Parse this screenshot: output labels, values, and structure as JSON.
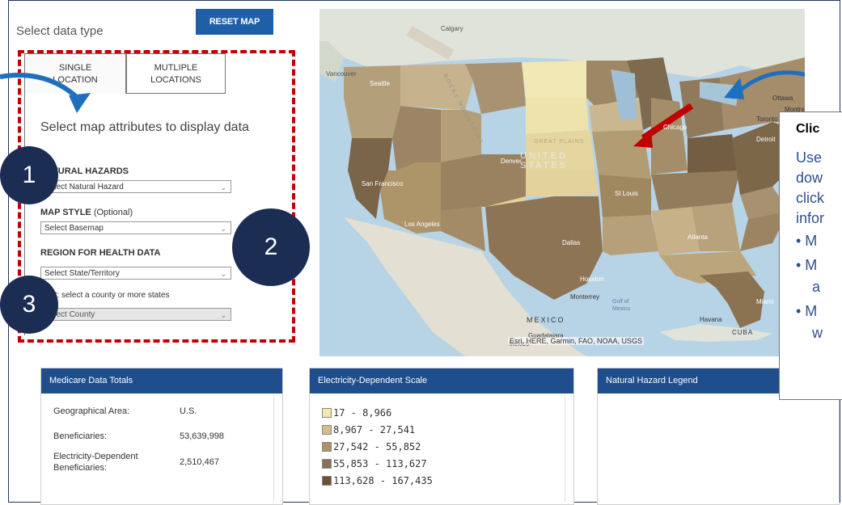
{
  "panel": {
    "select_label": "Select data type",
    "reset_label": "RESET MAP",
    "tabs": [
      {
        "line1": "SINGLE",
        "line2": "LOCATION"
      },
      {
        "line1": "MUTLIPLE",
        "line2": "LOCATIONS"
      }
    ],
    "prompt": "Select map attributes to display data",
    "natural_hazards_label": "NATURAL HAZARDS",
    "natural_hazards_value": "Select Natural Hazard",
    "map_style_label": "MAP STYLE",
    "map_style_optional": "(Optional)",
    "map_style_value": "Select Basemap",
    "region_label": "REGION FOR HEALTH DATA",
    "region_value": "Select State/Territory",
    "county_label": "Next: select a county or more states",
    "county_value": "Select County"
  },
  "steps": [
    "1",
    "2",
    "3"
  ],
  "map": {
    "attribution": "Esri, HERE, Garmin, FAO, NOAA, USGS",
    "labels": {
      "calgary": "Calgary",
      "vancouver": "Vancouver",
      "seattle": "Seattle",
      "sf": "San Francisco",
      "la": "Los Angeles",
      "denver": "Denver",
      "us": "UNITED STATES",
      "great_plains": "GREAT PLAINS",
      "stlouis": "St Louis",
      "dallas": "Dallas",
      "houston": "Houston",
      "atlanta": "Atlanta",
      "chicago": "Chicago",
      "toronto": "Toronto",
      "montreal": "Montreal",
      "detroit": "Detroit",
      "mexico": "MEXICO",
      "guadalajara": "Guadalajara",
      "gulf": "Gulf of Mexico",
      "havana": "Havana",
      "cuba": "CUBA",
      "miami": "Miami",
      "monterrey": "Monterrey",
      "rocky": "ROCKY MOUNTAINS",
      "mexico_city": "Mexico",
      "ottawa": "Ottawa"
    }
  },
  "medicare": {
    "title": "Medicare Data Totals",
    "rows": [
      {
        "label": "Geographical Area:",
        "value": "U.S."
      },
      {
        "label": "Beneficiaries:",
        "value": "53,639,998"
      },
      {
        "label": "Electricity-Dependent Beneficiaries:",
        "value": "2,510,467"
      }
    ]
  },
  "scale": {
    "title": "Electricity-Dependent Scale",
    "items": [
      {
        "range": "17 - 8,966",
        "color": "#f3e7a9"
      },
      {
        "range": "8,967 - 27,541",
        "color": "#d3bd8a"
      },
      {
        "range": "27,542 - 55,852",
        "color": "#ad9467"
      },
      {
        "range": "55,853 - 113,627",
        "color": "#87715a"
      },
      {
        "range": "113,628 - 167,435",
        "color": "#6b5237"
      }
    ]
  },
  "hazard": {
    "title": "Natural Hazard Legend"
  },
  "callout": {
    "title": "Clic",
    "lines": [
      "Use",
      "dow",
      "click",
      "infor",
      "• M",
      "• M",
      "a",
      "• M",
      "w"
    ]
  },
  "colors": {
    "accent": "#1f4e8c",
    "callout_text": "#2f4f8f",
    "dash": "#c00000",
    "circle": "#1c2d54",
    "arrow": "#1f6fbf"
  }
}
